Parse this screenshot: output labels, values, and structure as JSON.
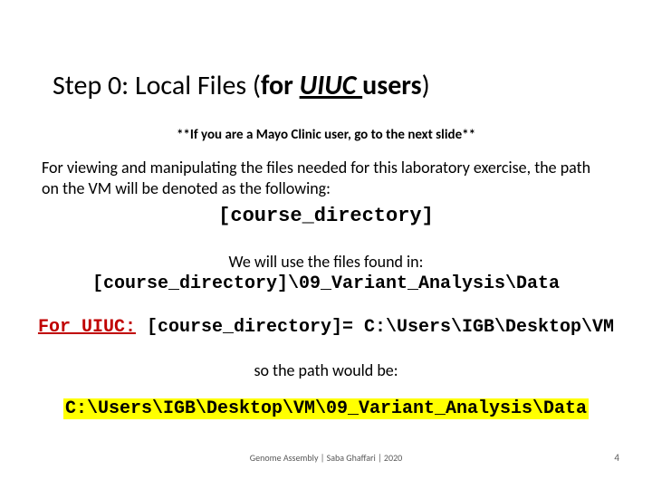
{
  "title": {
    "pre": "Step 0: Local Files (",
    "bold_pre": "for ",
    "uiuc": "UIUC ",
    "bold_post": "users",
    "post": ")"
  },
  "note": "**If you are a Mayo Clinic user, go to the next slide**",
  "body1": "For viewing and manipulating the files needed for this laboratory exercise, the path on the VM will be denoted as the following:",
  "course_dir": "[course_directory]",
  "body2": "We will use the files found in:",
  "path1": "[course_directory]\\09_Variant_Analysis\\Data",
  "for_label": "For UIUC:",
  "eq_text": " [course_directory]= C:\\Users\\IGB\\Desktop\\VM",
  "body3": "so the path would be:",
  "path2": "C:\\Users\\IGB\\Desktop\\VM\\09_Variant_Analysis\\Data",
  "footer": "Genome Assembly | Saba Ghaffari | 2020",
  "page": "4"
}
